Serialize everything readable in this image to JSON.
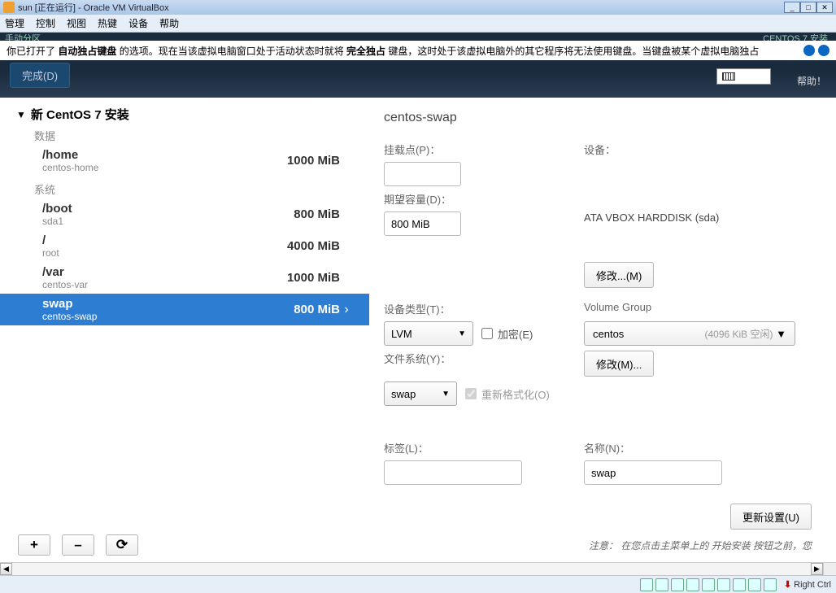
{
  "window": {
    "title": "sun [正在运行] - Oracle VM VirtualBox",
    "menu": [
      "管理",
      "控制",
      "视图",
      "热键",
      "设备",
      "帮助"
    ]
  },
  "notification": {
    "pre": "你已打开了 ",
    "b1": "自动独占键盘",
    "mid1": " 的选项。现在当该虚拟电脑窗口处于活动状态时就将 ",
    "b2": "完全独占",
    "mid2": " 键盘，这时处于该虚拟电脑外的其它程序将无法使用键盘。当键盘被某个虚拟电脑独占"
  },
  "installer_header": {
    "topstrip_left": "手动分区",
    "topstrip_right": "CENTOS 7 安装",
    "done": "完成(D)",
    "help": "帮助！",
    "lang": "cn"
  },
  "left": {
    "tree_title": "新 CentOS 7 安装",
    "section_data": "数据",
    "section_system": "系统",
    "partitions": [
      {
        "mount": "/home",
        "sub": "centos-home",
        "size": "1000 MiB"
      },
      {
        "mount": "/boot",
        "sub": "sda1",
        "size": "800 MiB"
      },
      {
        "mount": "/",
        "sub": "root",
        "size": "4000 MiB"
      },
      {
        "mount": "/var",
        "sub": "centos-var",
        "size": "1000 MiB"
      },
      {
        "mount": "swap",
        "sub": "centos-swap",
        "size": "800 MiB"
      }
    ],
    "toolbar": {
      "add": "+",
      "remove": "–",
      "reload": "⟳"
    }
  },
  "right": {
    "title": "centos-swap",
    "labels": {
      "mountpoint": "挂载点(P)：",
      "device": "设备：",
      "capacity": "期望容量(D)：",
      "device_val": "ATA VBOX HARDDISK (sda)",
      "modify": "修改...(M)",
      "devtype": "设备类型(T)：",
      "vg": "Volume Group",
      "encrypt": "加密(E)",
      "fstype": "文件系统(Y)：",
      "reformat": "重新格式化(O)",
      "modify2": "修改(M)...",
      "label": "标签(L)：",
      "name": "名称(N)：",
      "update": "更新设置(U)"
    },
    "values": {
      "capacity": "800 MiB",
      "devtype": "LVM",
      "fstype": "swap",
      "vg_name": "centos",
      "vg_free": "(4096 KiB 空闲)",
      "name": "swap"
    },
    "footer": "注意： 在您点击主菜单上的 开始安装 按钮之前，您"
  },
  "statusbar": {
    "hostkey": "Right Ctrl"
  }
}
